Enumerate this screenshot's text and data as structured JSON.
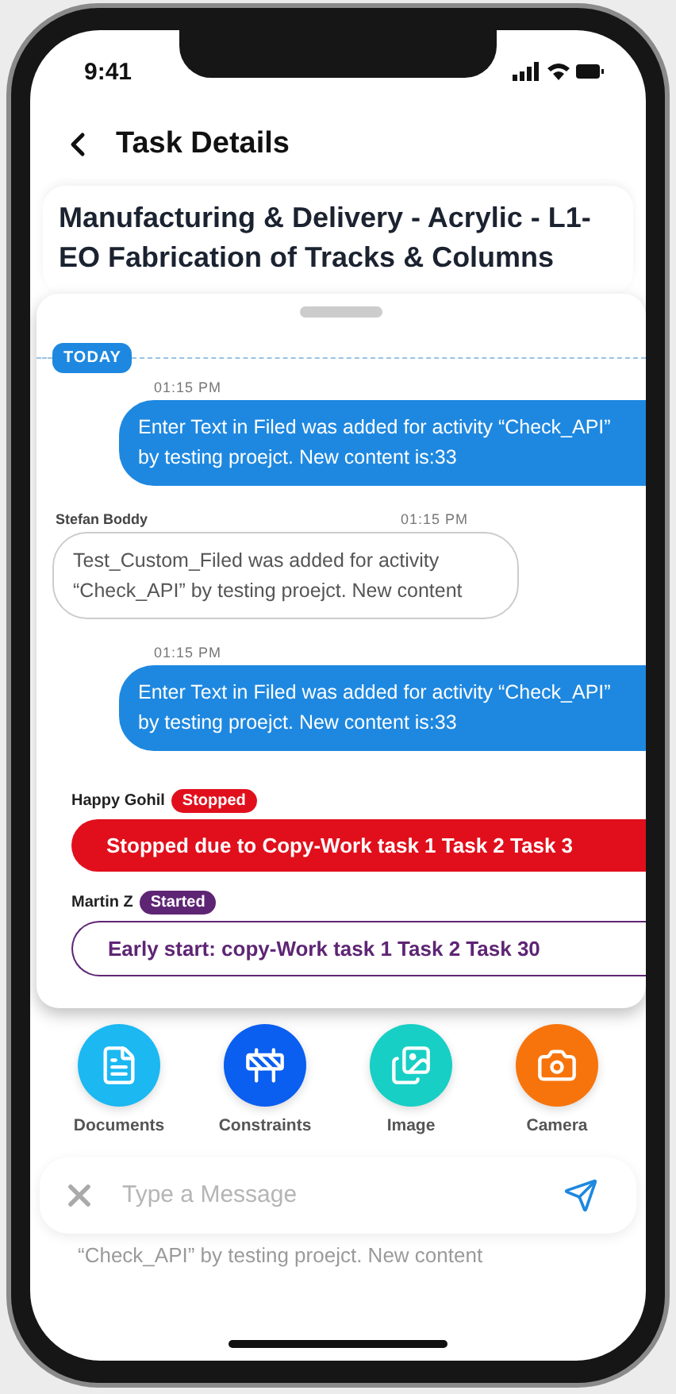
{
  "status_bar": {
    "time": "9:41"
  },
  "header": {
    "title": "Task Details"
  },
  "task_title": "Manufacturing & Delivery - Acrylic - L1-EO Fabrication of Tracks & Columns",
  "chat": {
    "date_label": "TODAY",
    "messages": [
      {
        "kind": "outgoing",
        "time": "01:15 PM",
        "text": "Enter Text in Filed was added for activity “Check_API” by testing proejct. New content is:33"
      },
      {
        "kind": "incoming",
        "sender": "Stefan Boddy",
        "time": "01:15 PM",
        "text": "Test_Custom_Filed was added for activity “Check_API” by testing proejct. New content"
      },
      {
        "kind": "outgoing",
        "time": "01:15 PM",
        "text": "Enter Text in Filed was added for activity “Check_API” by testing proejct. New content is:33"
      }
    ],
    "status_updates": [
      {
        "kind": "stopped",
        "name": "Happy Gohil",
        "status": "Stopped",
        "text": "Stopped due to Copy-Work task 1 Task 2 Task 3"
      },
      {
        "kind": "started",
        "name": "Martin Z",
        "status": "Started",
        "text": "Early start: copy-Work task 1 Task 2 Task 30"
      }
    ]
  },
  "attachments": [
    {
      "kind": "document",
      "label": "Documents",
      "color": "#1bb8f2"
    },
    {
      "kind": "constraint",
      "label": "Constraints",
      "color": "#0a5ef0"
    },
    {
      "kind": "image",
      "label": "Image",
      "color": "#17cfc4"
    },
    {
      "kind": "camera",
      "label": "Camera",
      "color": "#f7740c"
    }
  ],
  "composer": {
    "placeholder": "Type a Message"
  },
  "background_text": "“Check_API” by testing proejct. New content"
}
